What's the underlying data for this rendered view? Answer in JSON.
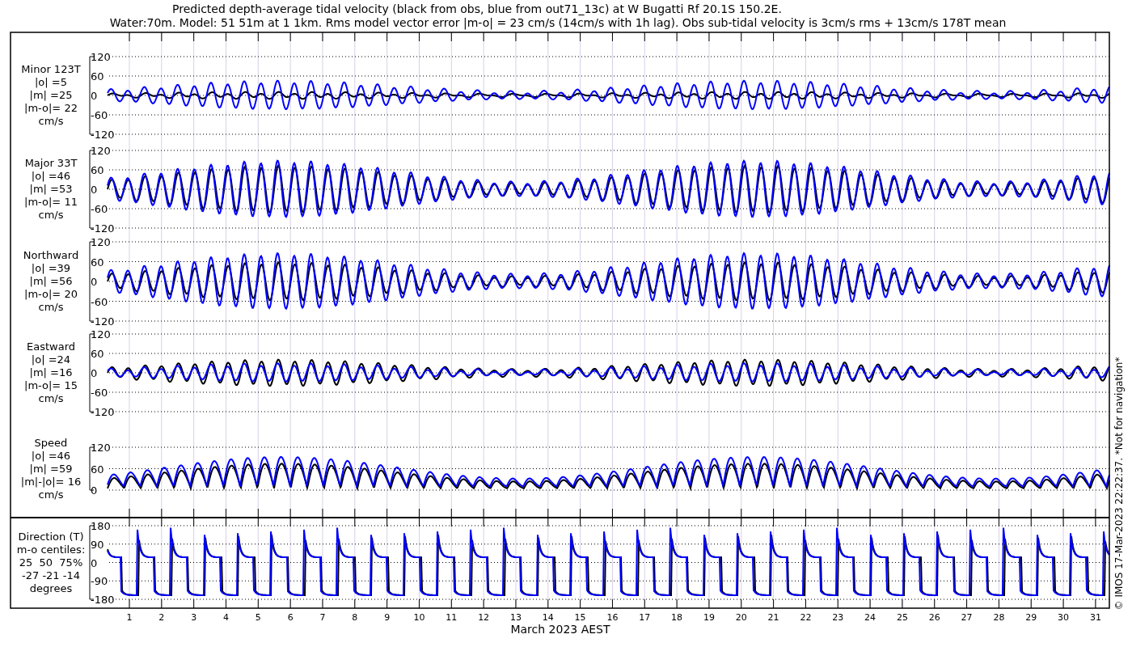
{
  "title": "Predicted depth-average tidal velocity (black from obs, blue from out71_13c) at W Bugatti Rf 20.1S 150.2E.",
  "subtitle": "Water:70m. Model: 51 51m at 1 1km. Rms model vector error |m-o| = 23 cm/s (14cm/s with 1h lag). Obs sub-tidal velocity is 3cm/s rms + 13cm/s 178T mean",
  "panels": [
    {
      "kind": "velocity",
      "label_lines": [
        "Minor 123T",
        "|o| =5",
        "|m| =25",
        "|m-o|= 22",
        "cm/s"
      ],
      "yticks": [
        "120",
        "60",
        "0",
        "-60",
        "-120"
      ]
    },
    {
      "kind": "velocity",
      "label_lines": [
        "Major 33T",
        "|o| =46",
        "|m| =53",
        "|m-o|= 11",
        "cm/s"
      ],
      "yticks": [
        "120",
        "60",
        "0",
        "-60",
        "-120"
      ]
    },
    {
      "kind": "velocity",
      "label_lines": [
        "Northward",
        "|o| =39",
        "|m| =56",
        "|m-o|= 20",
        "cm/s"
      ],
      "yticks": [
        "120",
        "60",
        "0",
        "-60",
        "-120"
      ]
    },
    {
      "kind": "velocity",
      "label_lines": [
        "Eastward",
        "|o| =24",
        "|m| =16",
        "|m-o|= 15",
        "cm/s"
      ],
      "yticks": [
        "120",
        "60",
        "0",
        "-60",
        "-120"
      ]
    },
    {
      "kind": "speed",
      "label_lines": [
        "Speed",
        "|o| =46",
        "|m| =59",
        "|m|-|o|= 16",
        "cm/s"
      ],
      "yticks": [
        "120",
        "60",
        "0"
      ]
    },
    {
      "kind": "direction",
      "label_lines": [
        "Direction (T)",
        "m-o centiles:",
        "25  50  75%",
        "-27 -21 -14",
        "degrees"
      ],
      "yticks": [
        "180",
        "90",
        "0",
        "-90",
        "-180"
      ]
    }
  ],
  "xticks": [
    "1",
    "2",
    "3",
    "4",
    "5",
    "6",
    "7",
    "8",
    "9",
    "10",
    "11",
    "12",
    "13",
    "14",
    "15",
    "16",
    "17",
    "18",
    "19",
    "20",
    "21",
    "22",
    "23",
    "24",
    "25",
    "26",
    "27",
    "28",
    "29",
    "30",
    "31"
  ],
  "xlabel": "March 2023 AEST",
  "footer": "© IMOS 17-Mar-2023 22:22:37. *Not for navigation*"
}
